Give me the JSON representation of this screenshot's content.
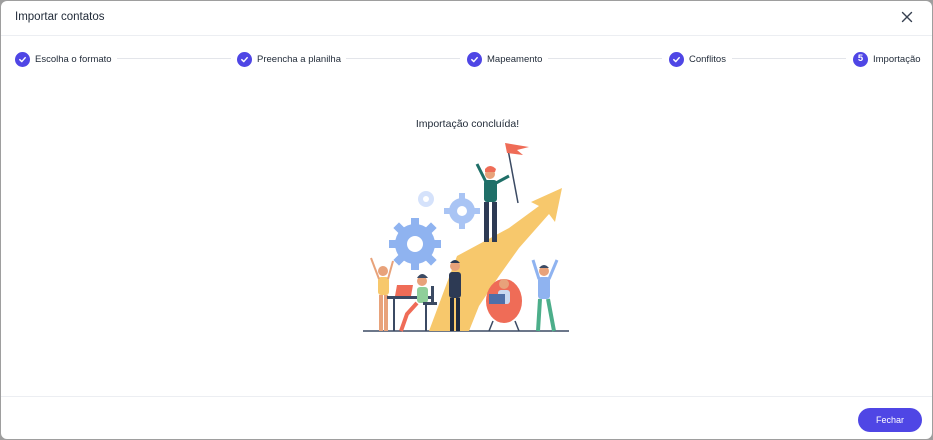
{
  "modal": {
    "title": "Importar contatos",
    "close_icon": "close-icon"
  },
  "stepper": {
    "steps": [
      {
        "label": "Escolha o formato",
        "state": "completed",
        "icon": "check-icon"
      },
      {
        "label": "Preencha a planilha",
        "state": "completed",
        "icon": "check-icon"
      },
      {
        "label": "Mapeamento",
        "state": "completed",
        "icon": "check-icon"
      },
      {
        "label": "Conflitos",
        "state": "completed",
        "icon": "check-icon"
      },
      {
        "label": "Importação",
        "state": "current",
        "number": "5"
      }
    ]
  },
  "content": {
    "message": "Importação concluída!",
    "illustration": "team-success-illustration"
  },
  "footer": {
    "close_button": "Fechar"
  },
  "colors": {
    "accent": "#4f46e5",
    "gear": "#8fb3f0",
    "arrow": "#f7c86c",
    "flag": "#ef6c57"
  }
}
